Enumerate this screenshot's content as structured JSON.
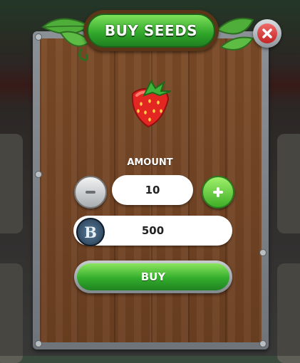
{
  "dialog": {
    "title": "BUY SEEDS",
    "close_icon": "close-x-icon",
    "item_icon": "strawberry-icon",
    "amount_label": "AMOUNT",
    "amount_value": "10",
    "decrease_icon": "minus-icon",
    "increase_icon": "plus-icon",
    "currency_icon": "blue-coin-icon",
    "currency_symbol": "B",
    "price": "500",
    "buy_label": "BUY"
  },
  "colors": {
    "green": "#33ad2d",
    "wood": "#6b3f21",
    "close_red": "#c42424",
    "coin_blue": "#22384d"
  }
}
